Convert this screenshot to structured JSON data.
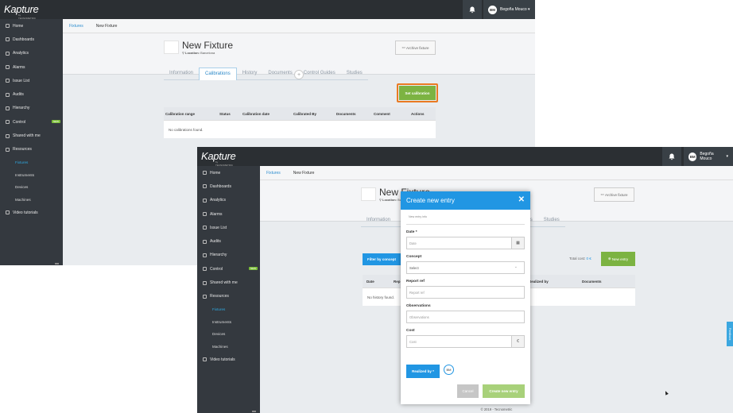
{
  "app": {
    "logo": "Kapture",
    "logo_sub": "by TECNOMETRIC"
  },
  "user": {
    "initials": "BM",
    "name": "Begoña Mouco"
  },
  "sidebar": {
    "items": [
      {
        "label": "Home"
      },
      {
        "label": "Dashboards"
      },
      {
        "label": "Analytics"
      },
      {
        "label": "Alarms"
      },
      {
        "label": "Issue List"
      },
      {
        "label": "Audits"
      },
      {
        "label": "Hierarchy"
      },
      {
        "label": "Control",
        "badge": "NEW"
      },
      {
        "label": "Shared with me"
      },
      {
        "label": "Resources"
      }
    ],
    "resources_sub": [
      "Fixtures",
      "Instruments",
      "Devices",
      "Machines"
    ],
    "video": "Video tutorials"
  },
  "breadcrumb": {
    "parent": "Fixtures",
    "current": "New Fixture"
  },
  "fixture": {
    "title": "New Fixture",
    "location_label": "Location:",
    "location": "Barcelona"
  },
  "archive_label": "Archive fixture",
  "tabs": [
    "Information",
    "Calibrations",
    "History",
    "Documents",
    "Control Guides",
    "Studies"
  ],
  "back_window": {
    "set_calibration": "Set calibration",
    "columns": [
      "Calibration range",
      "Status",
      "Calibration date",
      "Calibrated By",
      "Documents",
      "Comment",
      "Actions"
    ],
    "empty": "No calibrations found."
  },
  "front_window": {
    "filter": "Filter by concept",
    "total_cost_label": "Total cost:",
    "total_cost_value": "0 €",
    "new_entry": "New entry",
    "columns": [
      "Date",
      "Rep",
      "Realized by",
      "Documents"
    ],
    "empty": "No history found.",
    "footer": "© 2019 - Tecnometric"
  },
  "modal": {
    "title": "Create new entry",
    "hint": "New entry info",
    "date_label": "Date *",
    "date_placeholder": "Date",
    "concept_label": "Concept",
    "concept_value": "Select",
    "report_label": "Report ref",
    "report_placeholder": "Report ref",
    "obs_label": "Observations",
    "obs_placeholder": "Observations",
    "cost_label": "Cost",
    "cost_placeholder": "Cost",
    "cost_unit": "€",
    "realized_label": "Realized by *",
    "realized_user": "BM",
    "cancel": "Cancel",
    "create": "Create new entry"
  },
  "feedback": "Feedback"
}
